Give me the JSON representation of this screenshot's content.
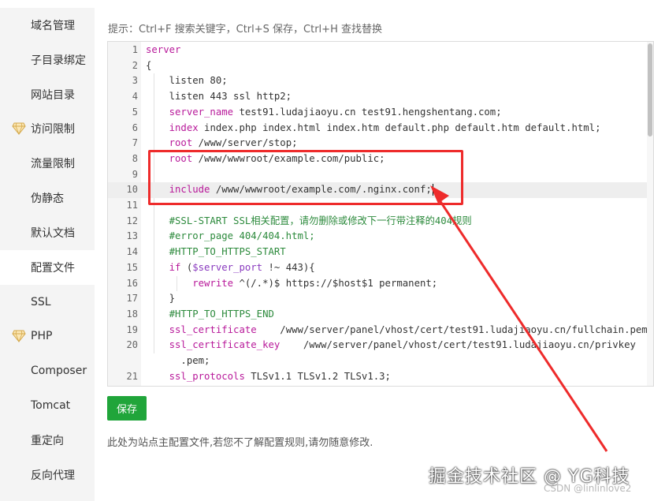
{
  "sidebar": {
    "items": [
      {
        "label": "域名管理",
        "gem": false,
        "active": false
      },
      {
        "label": "子目录绑定",
        "gem": false,
        "active": false
      },
      {
        "label": "网站目录",
        "gem": false,
        "active": false
      },
      {
        "label": "访问限制",
        "gem": true,
        "active": false
      },
      {
        "label": "流量限制",
        "gem": false,
        "active": false
      },
      {
        "label": "伪静态",
        "gem": false,
        "active": false
      },
      {
        "label": "默认文档",
        "gem": false,
        "active": false
      },
      {
        "label": "配置文件",
        "gem": false,
        "active": true
      },
      {
        "label": "SSL",
        "gem": false,
        "active": false
      },
      {
        "label": "PHP",
        "gem": true,
        "active": false
      },
      {
        "label": "Composer",
        "gem": false,
        "active": false
      },
      {
        "label": "Tomcat",
        "gem": false,
        "active": false
      },
      {
        "label": "重定向",
        "gem": false,
        "active": false
      },
      {
        "label": "反向代理",
        "gem": false,
        "active": false
      }
    ]
  },
  "hint": "提示：Ctrl+F 搜索关键字，Ctrl+S 保存，Ctrl+H 查找替换",
  "editor": {
    "current_line": 10,
    "lines": [
      {
        "n": "1",
        "parts": [
          [
            "kw",
            "server"
          ]
        ]
      },
      {
        "n": "2",
        "parts": [
          [
            "str",
            "{"
          ]
        ]
      },
      {
        "n": "3",
        "parts": [
          [
            "str",
            "    listen 80;"
          ]
        ]
      },
      {
        "n": "4",
        "parts": [
          [
            "str",
            "    listen 443 ssl http2;"
          ]
        ]
      },
      {
        "n": "5",
        "parts": [
          [
            "kw",
            "    server_name"
          ],
          [
            "str",
            " test91.ludajiaoyu.cn test91.hengshentang.com;"
          ]
        ]
      },
      {
        "n": "6",
        "parts": [
          [
            "kw",
            "    index"
          ],
          [
            "str",
            " index.php index.html index.htm default.php default.htm default.html;"
          ]
        ]
      },
      {
        "n": "7",
        "parts": [
          [
            "kw",
            "    root"
          ],
          [
            "str",
            " /www/server/stop;"
          ]
        ]
      },
      {
        "n": "8",
        "parts": [
          [
            "kw",
            "    root"
          ],
          [
            "str",
            " /www/wwwroot/example.com/public;"
          ]
        ]
      },
      {
        "n": "9",
        "parts": [
          [
            "str",
            ""
          ]
        ]
      },
      {
        "n": "10",
        "parts": [
          [
            "kw",
            "    include"
          ],
          [
            "str",
            " /www/wwwroot/example.com/.nginx.conf;"
          ]
        ]
      },
      {
        "n": "11",
        "parts": [
          [
            "str",
            ""
          ]
        ]
      },
      {
        "n": "12",
        "parts": [
          [
            "cm",
            "    #SSL-START SSL相关配置，请勿删除或修改下一行带注释的404规则"
          ]
        ]
      },
      {
        "n": "13",
        "parts": [
          [
            "cm",
            "    #error_page 404/404.html;"
          ]
        ]
      },
      {
        "n": "14",
        "parts": [
          [
            "cm",
            "    #HTTP_TO_HTTPS_START"
          ]
        ]
      },
      {
        "n": "15",
        "parts": [
          [
            "kw",
            "    if"
          ],
          [
            "str",
            " ("
          ],
          [
            "var",
            "$server_port"
          ],
          [
            "str",
            " !~ 443){"
          ]
        ]
      },
      {
        "n": "16",
        "parts": [
          [
            "kw",
            "        rewrite"
          ],
          [
            "str",
            " ^(/.*)$ https://$host$1 permanent;"
          ]
        ]
      },
      {
        "n": "17",
        "parts": [
          [
            "str",
            "    }"
          ]
        ]
      },
      {
        "n": "18",
        "parts": [
          [
            "cm",
            "    #HTTP_TO_HTTPS_END"
          ]
        ]
      },
      {
        "n": "19",
        "parts": [
          [
            "kw",
            "    ssl_certificate"
          ],
          [
            "str",
            "    /www/server/panel/vhost/cert/test91.ludajiaoyu.cn/fullchain.pem;"
          ]
        ]
      },
      {
        "n": "20",
        "parts": [
          [
            "kw",
            "    ssl_certificate_key"
          ],
          [
            "str",
            "    /www/server/panel/vhost/cert/test91.ludajiaoyu.cn/privkey"
          ]
        ]
      },
      {
        "n": "",
        "parts": [
          [
            "str",
            "      .pem;"
          ]
        ]
      },
      {
        "n": "21",
        "parts": [
          [
            "kw",
            "    ssl_protocols"
          ],
          [
            "str",
            " TLSv1.1 TLSv1.2 TLSv1.3;"
          ]
        ]
      }
    ]
  },
  "save_label": "保存",
  "note": "此处为站点主配置文件,若您不了解配置规则,请勿随意修改.",
  "watermark": "掘金技术社区 @ YG科技",
  "csdn_mark": "CSDN @linlinlove2",
  "colors": {
    "accent": "#20a53a",
    "annotation": "#ee2b2b"
  }
}
